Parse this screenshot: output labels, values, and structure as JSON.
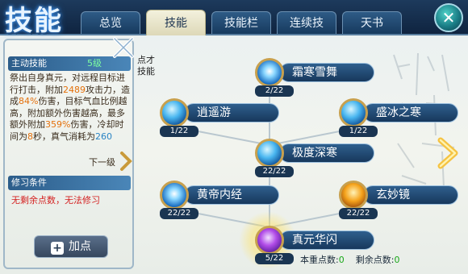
{
  "header": {
    "title": "技能",
    "tabs": [
      "总览",
      "技能",
      "技能栏",
      "连续技",
      "天书"
    ],
    "active_tab": "技能"
  },
  "left_panel": {
    "section_title": "主动技能",
    "level": "5级",
    "desc": {
      "part1": "祭出自身真元，对远程目标进行打击，附加",
      "n1": "2489",
      "part2": "攻击力，造成",
      "n2": "84%",
      "part3": "伤害，目标气血比例越高，附加额外伤害越高，最多额外附加",
      "n3": "359%",
      "part4": "伤害，冷却时间为",
      "n4": "8",
      "part5": "秒，真气消耗为",
      "n5": "260"
    },
    "next_level_label": "下一级",
    "cond_title": "修习条件",
    "cond_text": "无剩余点数，无法修习",
    "add_point_label": "加点"
  },
  "tree": {
    "label_line1": "点才",
    "label_line2": "技能",
    "nodes": [
      {
        "name": "霜寒雪舞",
        "count": "2/22"
      },
      {
        "name": "逍遥游",
        "count": "1/22"
      },
      {
        "name": "盛冰之寒",
        "count": "1/22"
      },
      {
        "name": "极度深寒",
        "count": "22/22"
      },
      {
        "name": "黄帝内经",
        "count": "22/22"
      },
      {
        "name": "玄妙镜",
        "count": "22/22"
      },
      {
        "name": "真元华闪",
        "count": "5/22"
      }
    ]
  },
  "footer": {
    "points_label": "本重点数:",
    "points_value": "0",
    "remain_label": "剩余点数:",
    "remain_value": "0"
  }
}
